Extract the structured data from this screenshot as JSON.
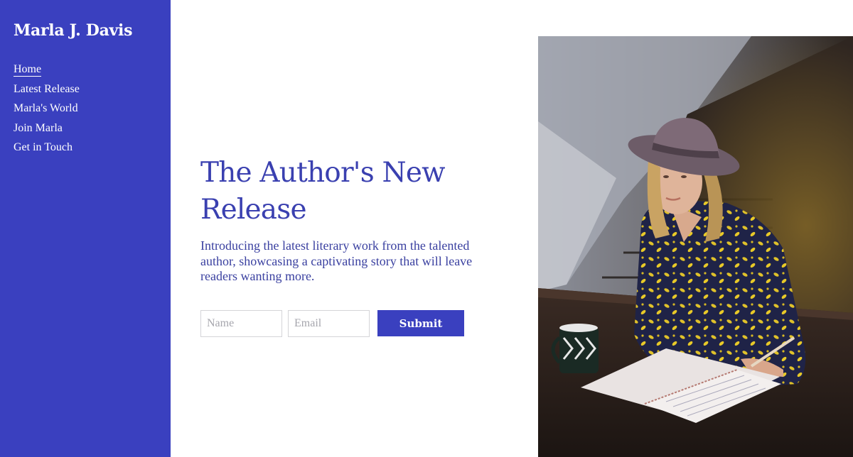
{
  "sidebar": {
    "site_title": "Marla J. Davis",
    "nav": [
      {
        "label": "Home",
        "active": true
      },
      {
        "label": "Latest Release",
        "active": false
      },
      {
        "label": "Marla's World",
        "active": false
      },
      {
        "label": "Join Marla",
        "active": false
      },
      {
        "label": "Get in Touch",
        "active": false
      }
    ]
  },
  "hero": {
    "title": "The Author's New Release",
    "description": "Introducing the latest literary work from the talented author, showcasing a captivating story that will leave readers wanting more."
  },
  "form": {
    "name_placeholder": "Name",
    "email_placeholder": "Email",
    "submit_label": "Submit"
  },
  "colors": {
    "accent": "#3a40bf",
    "heading": "#3a40b0",
    "background": "#ffffff"
  }
}
